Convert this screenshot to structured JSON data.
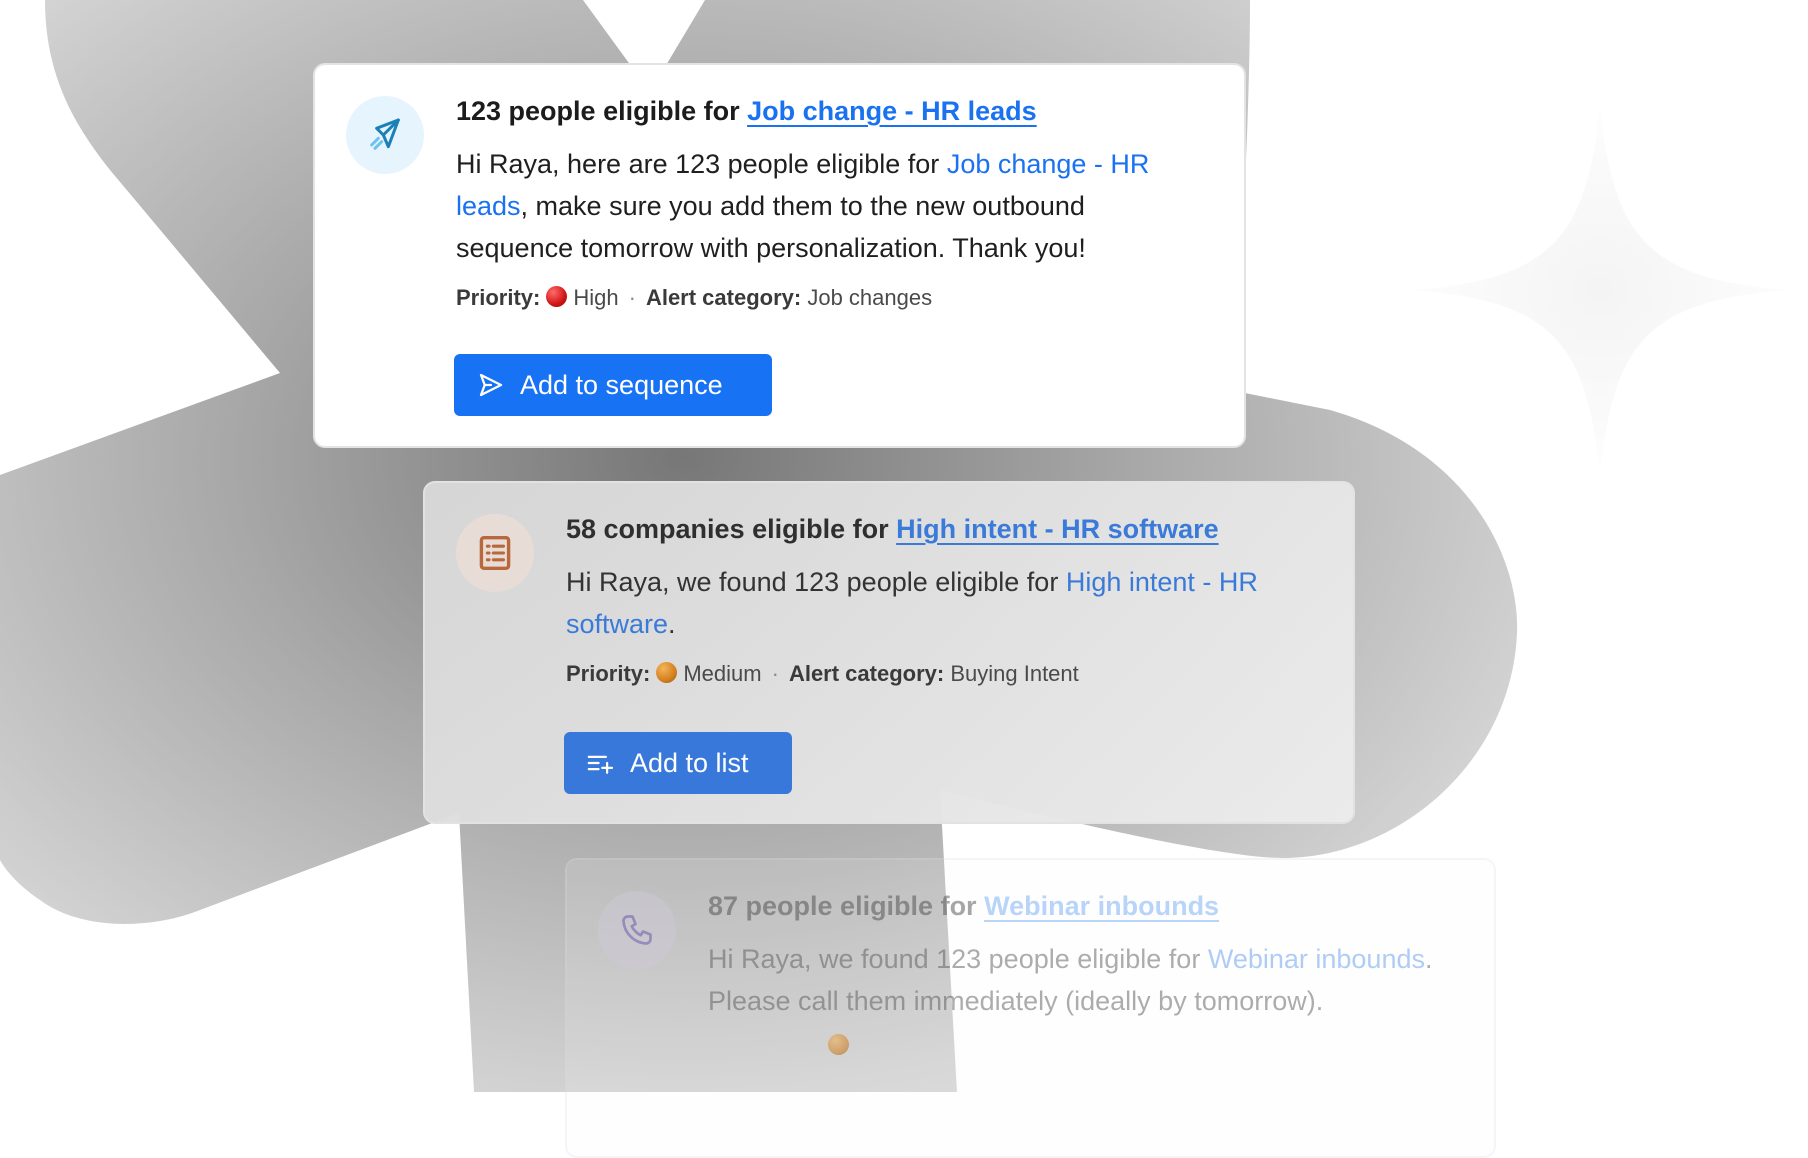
{
  "alerts": [
    {
      "icon": "paper-plane-icon",
      "title_prefix": "123 people eligible for ",
      "title_link": "Job change - HR leads",
      "body_prefix": "Hi Raya, here are 123 people eligible for ",
      "body_link": "Job change - HR leads",
      "body_suffix": ", make sure you add them to the new outbound sequence tomorrow with personalization. Thank you!",
      "priority_label": "Priority:",
      "priority_value": "High",
      "priority_color": "#d01515",
      "category_label": "Alert category:",
      "category_value": "Job changes",
      "separator": "·",
      "action_label": "Add to sequence",
      "action_icon": "send-icon"
    },
    {
      "icon": "list-icon",
      "title_prefix": "58 companies eligible for ",
      "title_link": "High intent - HR software",
      "body_prefix": "Hi Raya, we found 123 people eligible for ",
      "body_link": "High intent - HR software",
      "body_suffix": ".",
      "priority_label": "Priority:",
      "priority_value": "Medium",
      "priority_color": "#d4801f",
      "category_label": "Alert category:",
      "category_value": "Buying Intent",
      "separator": "·",
      "action_label": "Add to list",
      "action_icon": "list-add-icon"
    },
    {
      "icon": "phone-icon",
      "title_prefix": "87 people eligible for ",
      "title_link": "Webinar inbounds",
      "body_prefix": "Hi Raya, we found 123 people eligible for ",
      "body_link": "Webinar inbounds",
      "body_suffix": ". Please call them immediately (ideally by tomorrow)."
    }
  ],
  "colors": {
    "primary_button": "#1872f4",
    "link": "#1a72f0",
    "background_shape": "#b0b0b0"
  }
}
